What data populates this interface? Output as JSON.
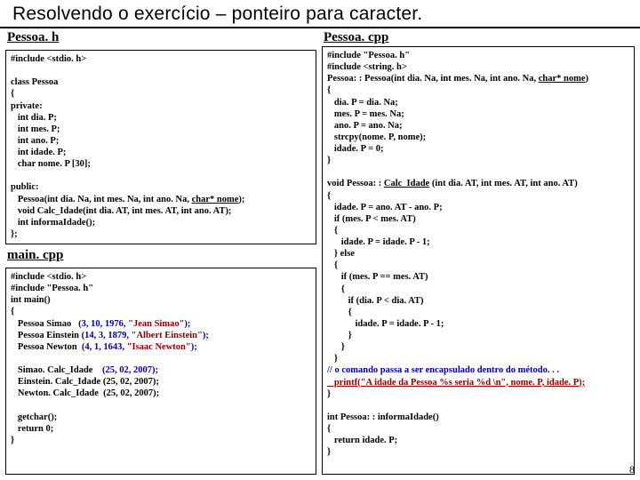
{
  "title": "Resolvendo o exercício – ponteiro para caracter.",
  "labels": {
    "pessoa_h": "Pessoa. h",
    "main_cpp": "main. cpp",
    "pessoa_cpp": "Pessoa. cpp"
  },
  "code": {
    "pessoa_h": {
      "l1": "#include <stdio. h>",
      "l2": "class Pessoa",
      "l3": "{",
      "l4": "private:",
      "l5": "   int dia. P;",
      "l6": "   int mes. P;",
      "l7": "   int ano. P;",
      "l8": "   int idade. P;",
      "l9": "   char nome. P [30];",
      "l10": "public:",
      "l11a": "   Pessoa(int dia. Na, int mes. Na, int ano. Na, ",
      "l11b": "char* nome",
      "l11c": ");",
      "l12": "   void Calc_Idade(int dia. AT, int mes. AT, int ano. AT);",
      "l13": "   int informaIdade();",
      "l14": "};"
    },
    "main_cpp": {
      "l1": "#include <stdio. h>",
      "l2": "#include \"Pessoa. h\"",
      "l3": "int main()",
      "l4": "{",
      "l5": "   Pessoa Simao",
      "l5a": "(3, 10, 1976, ",
      "l5b": "\"Jean Simao\"",
      "l5c": ");",
      "l6": "   Pessoa Einstein",
      "l6a": "(14, 3, 1879, ",
      "l6b": "\"Albert Einstein\"",
      "l6c": ");",
      "l7": "   Pessoa Newton",
      "l7a": "(4, 1, 1643, ",
      "l7b": "\"Isaac Newton\"",
      "l7c": ");",
      "l9": "   Simao. Calc_Idade",
      "l9a": "(25, 02, 2007",
      "l9b": ");",
      "l10": "   Einstein. Calc_Idade (25, 02, 2007);",
      "l11": "   Newton. Calc_Idade  (25, 02, 2007);",
      "l13": "   getchar();",
      "l14": "   return 0;",
      "l15": "}"
    },
    "pessoa_cpp": {
      "l1": "#include \"Pessoa. h\"",
      "l2": "#include <string. h>",
      "l3a": "Pessoa: : Pessoa(int dia. Na, int mes. Na, int ano. Na, ",
      "l3b": "char* nome",
      "l3c": ")",
      "l4": "{",
      "l5": "   dia. P = dia. Na;",
      "l6": "   mes. P = mes. Na;",
      "l7": "   ano. P = ano. Na;",
      "l8": "   strcpy(nome. P, nome);",
      "l9": "   idade. P = 0;",
      "l10": "}",
      "m1a": "void Pessoa: : ",
      "m1b": "Calc_Idade",
      "m1c": " (int dia. AT, int mes. AT, int ano. AT)",
      "m2": "{",
      "m3": "   idade. P = ano. AT - ano. P;",
      "m4": "   if (mes. P < mes. AT)",
      "m5": "   {",
      "m6": "      idade. P = idade. P - 1;",
      "m7": "   } else",
      "m8": "   {",
      "m9": "      if (mes. P == mes. AT)",
      "m10": "      {",
      "m11": "         if (dia. P < dia. AT)",
      "m12": "         {",
      "m13": "            idade. P = idade. P - 1;",
      "m14": "         }",
      "m15": "      }",
      "m16": "   }",
      "c1": "// o comando passa a ser encapsulado dentro do método. . .",
      "p1": "   printf(\"A idade da Pessoa %s seria %d \\n\", nome. P, idade. P);",
      "m17": "}",
      "n1": "int Pessoa: : informaIdade()",
      "n2": "{",
      "n3": "   return idade. P;",
      "n4": "}"
    }
  },
  "page_number": "8"
}
